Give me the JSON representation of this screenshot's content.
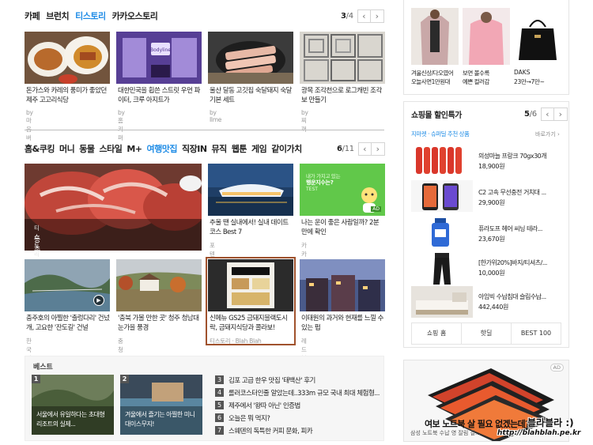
{
  "top_tabs": {
    "items": [
      "카페",
      "브런치",
      "티스토리",
      "카카오스토리"
    ],
    "active_index": 2,
    "pager_current": "3",
    "pager_total": "/4",
    "prev": "‹",
    "next": "›"
  },
  "top_cards": [
    {
      "title": "돈가스와 카레의 풍미가 좋았던 제주 고고리식당",
      "source": "by 마음버스"
    },
    {
      "title": "대한민국을 휩쓴 스트릿 우먼 파이터, 크루 아지트가",
      "source": "by 홈키퍼"
    },
    {
      "title": "울산 달동 고깃집 숙달돼지 숙달 기본 세트",
      "source": "by Ilme"
    },
    {
      "title": "광목 조각천으로 로그캐빈 조각보 만들기",
      "source": "by 찌꺼"
    }
  ],
  "mid_tabs": {
    "items": [
      "홈&쿠킹",
      "머니",
      "동물",
      "스타일",
      "M+",
      "여행맛집",
      "직장IN",
      "뮤직",
      "웹툰",
      "게임",
      "같이가치"
    ],
    "active_index": 5,
    "pager_current": "6",
    "pager_total": "/11",
    "prev": "‹",
    "next": "›"
  },
  "feature": {
    "tag": "티스토리 · 홀롱롱의 맛",
    "title": "등촌역에 새로 생긴 상무초밥 스시와 참치회의 맛"
  },
  "mid_row1": [
    {
      "title": "추울 땐 실내에서! 실내 데이트 코스 Best 7",
      "source": "포텐샵"
    },
    {
      "title": "나는 운이 좋은 사람일까? 2분만에 확인",
      "source": "카카오같이가치",
      "banner_line1": "내가 가지고 있는",
      "banner_line2": "행운지수는?",
      "banner_line3": "TEST",
      "badge": "AD"
    }
  ],
  "mid_row2": [
    {
      "title": "충주호의 아찔한 '출렁다리' 건넜개, 고요한 '잔도길' 건널",
      "source": "한국일보"
    },
    {
      "title": "'충북 가볼 만한 곳' 청주 청남대 눈가을 풍경",
      "source": "충청북도"
    },
    {
      "title": "신메뉴 GS25 금돼지블랙도시락, 금돼지식당과 콜라보!",
      "source": "티스토리 · Blah Blah"
    },
    {
      "title": "이태원의 과거와 현재를 느낄 수 있는 펍",
      "source": "레드볼"
    }
  ],
  "best": {
    "label": "베스트",
    "cards": [
      {
        "rank": "1",
        "title": "서울에서 유일하다는 초대형 리조트의 실제..."
      },
      {
        "rank": "2",
        "title": "겨울에서 즐기는 아찔한 미니대이스무지!"
      }
    ],
    "list": [
      {
        "rank": "3",
        "text": "김포 고급 한우 맛집 '태백산' 후기"
      },
      {
        "rank": "4",
        "text": "롤러코스터인줄 알았는데..333m 규모 국내 최대 체험형..."
      },
      {
        "rank": "5",
        "text": "제주에서 '왕따 아닌' 인증법"
      },
      {
        "rank": "6",
        "text": "오늘은 뭐 먹지?"
      },
      {
        "rank": "7",
        "text": "스웨덴의 독특한 커피 문화, 피카"
      }
    ]
  },
  "right_top": {
    "products": [
      {
        "line1": "겨울신상/다오였어",
        "line2": "오늘사면1만원대"
      },
      {
        "line1": "보면 볼수록",
        "line2": "예쁜 컬러감"
      },
      {
        "line1": "DAKS",
        "line2": "23만→7만~"
      }
    ]
  },
  "shopping": {
    "title": "쇼핑몰 할인특가",
    "pager_current": "5",
    "pager_total": "/6",
    "prev": "‹",
    "next": "›",
    "subtitle": "지마켓 · 슈퍼딜 추천 상품",
    "more": "바로가기 ›",
    "items": [
      {
        "name": "의성마늘 프랑크 70gx30개",
        "price": "18,900원"
      },
      {
        "name": "C2 고속 무선충전 거치대 ...",
        "price": "29,900원"
      },
      {
        "name": "퓨라도프 헤어 씨닝 테라...",
        "price": "23,670원"
      },
      {
        "name": "[한가위20%]바지/티셔츠/...",
        "price": "10,000원"
      },
      {
        "name": "아임빅 수납침대 슬림수납...",
        "price": "442,440원"
      }
    ],
    "buttons": [
      "쇼핑 홈",
      "핫딜",
      "BEST 100"
    ]
  },
  "ad": {
    "badge": "AD",
    "headline": "여보 노트북 살 필요 없겠는데?",
    "sub": "삼성 노트북 수납 영 잘림 결..."
  },
  "watermark": {
    "line1": "블라블라 :)",
    "line2": "http://blahblah.pe.kr"
  }
}
